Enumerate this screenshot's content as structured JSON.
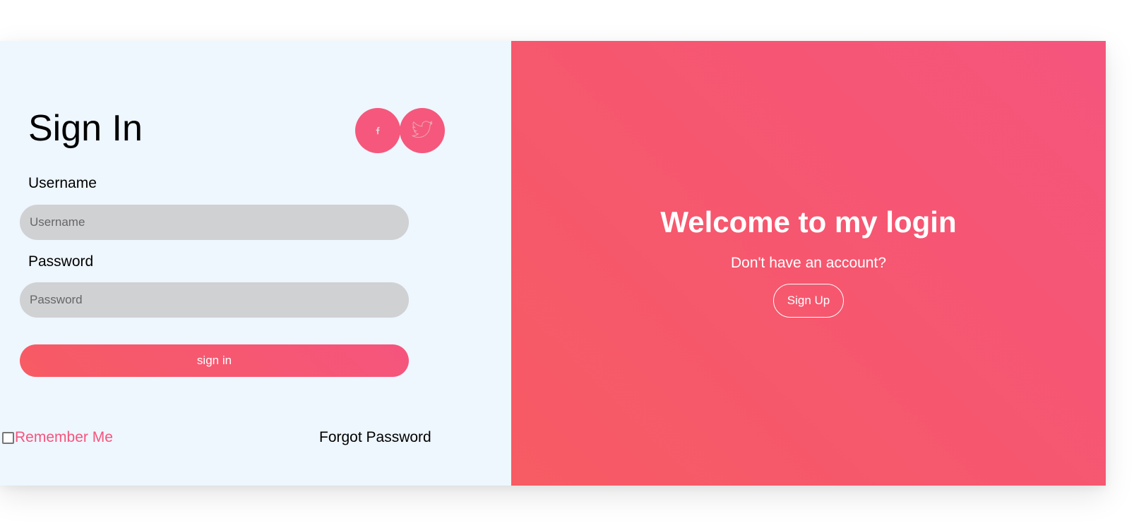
{
  "signin": {
    "title": "Sign In",
    "username_label": "Username",
    "username_placeholder": "Username",
    "password_label": "Password",
    "password_placeholder": "Password",
    "submit_label": "sign in",
    "remember_label": "Remember Me",
    "forgot_label": "Forgot Password",
    "social_icons": [
      "facebook-icon",
      "twitter-icon"
    ]
  },
  "welcome_panel": {
    "heading": "Welcome to my login",
    "subtext": "Don't have an account?",
    "signup_label": "Sign Up"
  },
  "colors": {
    "accent": "#f5557d",
    "gradient_start": "#f75b63",
    "gradient_end": "#f5557d",
    "left_panel_bg": "#eef6fe",
    "input_bg": "#d0d1d3"
  }
}
